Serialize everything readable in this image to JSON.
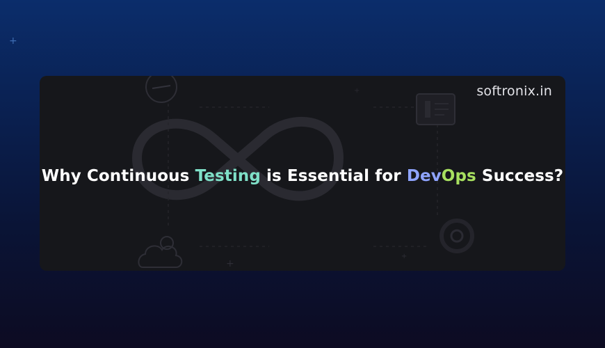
{
  "brand": "softronix.in",
  "headline": {
    "part1": "Why Continuous ",
    "testing": "Testing",
    "part2": " is Essential for ",
    "dev": "Dev",
    "ops": "Ops",
    "part3": " Success?"
  },
  "colors": {
    "background_top": "#0b2d6b",
    "background_bottom": "#0d0b22",
    "card": "#16171b",
    "highlight_testing": "#7fe0c8",
    "highlight_dev": "#8fa4ff",
    "highlight_ops": "#a8e060"
  },
  "icons": [
    "stopwatch-icon",
    "document-icon",
    "cloud-gear-icon",
    "gear-icon",
    "infinity-loop-icon",
    "sparkle-icon"
  ]
}
